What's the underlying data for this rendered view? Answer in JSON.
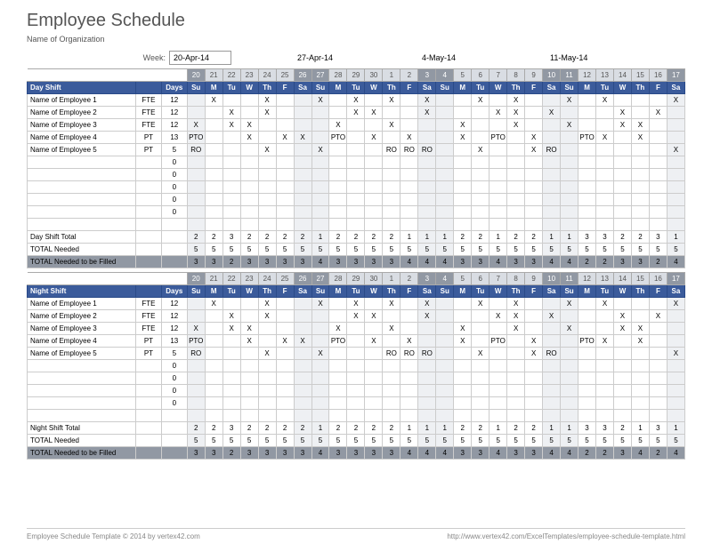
{
  "title": "Employee Schedule",
  "subtitle": "Name of Organization",
  "week_label": "Week:",
  "week_dates": [
    "20-Apr-14",
    "27-Apr-14",
    "4-May-14",
    "11-May-14"
  ],
  "col_type_blank": "",
  "col_days": "Days",
  "day_numbers": [
    "20",
    "21",
    "22",
    "23",
    "24",
    "25",
    "26",
    "27",
    "28",
    "29",
    "30",
    "1",
    "2",
    "3",
    "4",
    "5",
    "6",
    "7",
    "8",
    "9",
    "10",
    "11",
    "12",
    "13",
    "14",
    "15",
    "16",
    "17"
  ],
  "day_abbr": [
    "Su",
    "M",
    "Tu",
    "W",
    "Th",
    "F",
    "Sa",
    "Su",
    "M",
    "Tu",
    "W",
    "Th",
    "F",
    "Sa",
    "Su",
    "M",
    "Tu",
    "W",
    "Th",
    "F",
    "Sa",
    "Su",
    "M",
    "Tu",
    "W",
    "Th",
    "F",
    "Sa"
  ],
  "weekend_idx": [
    0,
    6,
    7,
    13,
    14,
    20,
    21,
    27
  ],
  "shifts": [
    {
      "name": "Day Shift",
      "employees": [
        {
          "n": "Name of Employee 1",
          "t": "FTE",
          "d": "12",
          "marks": [
            "",
            "X",
            "",
            "",
            "X",
            "",
            "",
            "X",
            "",
            "X",
            "",
            "X",
            "",
            "X",
            "",
            "",
            "X",
            "",
            "X",
            "",
            "",
            "X",
            "",
            "X",
            "",
            "",
            "",
            "X"
          ]
        },
        {
          "n": "Name of Employee 2",
          "t": "FTE",
          "d": "12",
          "marks": [
            "",
            "",
            "X",
            "",
            "X",
            "",
            "",
            "",
            "",
            "X",
            "X",
            "",
            "",
            "X",
            "",
            "",
            "",
            "X",
            "X",
            "",
            "X",
            "",
            "",
            "",
            "X",
            "",
            "X",
            ""
          ]
        },
        {
          "n": "Name of Employee 3",
          "t": "FTE",
          "d": "12",
          "marks": [
            "X",
            "",
            "X",
            "X",
            "",
            "",
            "",
            "",
            "X",
            "",
            "",
            "X",
            "",
            "",
            "",
            "X",
            "",
            "",
            "X",
            "",
            "",
            "X",
            "",
            "",
            "X",
            "X",
            "",
            ""
          ]
        },
        {
          "n": "Name of Employee 4",
          "t": "PT",
          "d": "13",
          "marks": [
            "PTO",
            "",
            "",
            "X",
            "",
            "X",
            "X",
            "",
            "PTO",
            "",
            "X",
            "",
            "X",
            "",
            "",
            "X",
            "",
            "PTO",
            "",
            "X",
            "",
            "",
            "PTO",
            "X",
            "",
            "X",
            "",
            ""
          ]
        },
        {
          "n": "Name of Employee 5",
          "t": "PT",
          "d": "5",
          "marks": [
            "RO",
            "",
            "",
            "",
            "X",
            "",
            "",
            "X",
            "",
            "",
            "",
            "RO",
            "RO",
            "RO",
            "",
            "",
            "X",
            "",
            "",
            "X",
            "RO",
            "",
            "",
            "",
            "",
            "",
            "",
            "X"
          ]
        }
      ],
      "empty_rows": 5,
      "total_label": "Day Shift Total",
      "total": [
        "2",
        "2",
        "3",
        "2",
        "2",
        "2",
        "2",
        "1",
        "2",
        "2",
        "2",
        "2",
        "1",
        "1",
        "1",
        "2",
        "2",
        "1",
        "2",
        "2",
        "1",
        "1",
        "3",
        "3",
        "2",
        "2",
        "3",
        "1"
      ],
      "need_label": "TOTAL Needed",
      "need": [
        "5",
        "5",
        "5",
        "5",
        "5",
        "5",
        "5",
        "5",
        "5",
        "5",
        "5",
        "5",
        "5",
        "5",
        "5",
        "5",
        "5",
        "5",
        "5",
        "5",
        "5",
        "5",
        "5",
        "5",
        "5",
        "5",
        "5",
        "5"
      ],
      "fill_label": "TOTAL Needed to be Filled",
      "fill": [
        "3",
        "3",
        "2",
        "3",
        "3",
        "3",
        "3",
        "4",
        "3",
        "3",
        "3",
        "3",
        "4",
        "4",
        "4",
        "3",
        "3",
        "4",
        "3",
        "3",
        "4",
        "4",
        "2",
        "2",
        "3",
        "3",
        "2",
        "4"
      ]
    },
    {
      "name": "Night Shift",
      "employees": [
        {
          "n": "Name of Employee 1",
          "t": "FTE",
          "d": "12",
          "marks": [
            "",
            "X",
            "",
            "",
            "X",
            "",
            "",
            "X",
            "",
            "X",
            "",
            "X",
            "",
            "X",
            "",
            "",
            "X",
            "",
            "X",
            "",
            "",
            "X",
            "",
            "X",
            "",
            "",
            "",
            "X"
          ]
        },
        {
          "n": "Name of Employee 2",
          "t": "FTE",
          "d": "12",
          "marks": [
            "",
            "",
            "X",
            "",
            "X",
            "",
            "",
            "",
            "",
            "X",
            "X",
            "",
            "",
            "X",
            "",
            "",
            "",
            "X",
            "X",
            "",
            "X",
            "",
            "",
            "",
            "X",
            "",
            "X",
            ""
          ]
        },
        {
          "n": "Name of Employee 3",
          "t": "FTE",
          "d": "12",
          "marks": [
            "X",
            "",
            "X",
            "X",
            "",
            "",
            "",
            "",
            "X",
            "",
            "",
            "X",
            "",
            "",
            "",
            "X",
            "",
            "",
            "X",
            "",
            "",
            "X",
            "",
            "",
            "X",
            "X",
            "",
            ""
          ]
        },
        {
          "n": "Name of Employee 4",
          "t": "PT",
          "d": "13",
          "marks": [
            "PTO",
            "",
            "",
            "X",
            "",
            "X",
            "X",
            "",
            "PTO",
            "",
            "X",
            "",
            "X",
            "",
            "",
            "X",
            "",
            "PTO",
            "",
            "X",
            "",
            "",
            "PTO",
            "X",
            "",
            "X",
            "",
            ""
          ]
        },
        {
          "n": "Name of Employee 5",
          "t": "PT",
          "d": "5",
          "marks": [
            "RO",
            "",
            "",
            "",
            "X",
            "",
            "",
            "X",
            "",
            "",
            "",
            "RO",
            "RO",
            "RO",
            "",
            "",
            "X",
            "",
            "",
            "X",
            "RO",
            "",
            "",
            "",
            "",
            "",
            "",
            "X"
          ]
        }
      ],
      "empty_rows": 4,
      "total_label": "Night Shift Total",
      "total": [
        "2",
        "2",
        "3",
        "2",
        "2",
        "2",
        "2",
        "1",
        "2",
        "2",
        "2",
        "2",
        "1",
        "1",
        "1",
        "2",
        "2",
        "1",
        "2",
        "2",
        "1",
        "1",
        "3",
        "3",
        "2",
        "1",
        "3",
        "1"
      ],
      "need_label": "TOTAL Needed",
      "need": [
        "5",
        "5",
        "5",
        "5",
        "5",
        "5",
        "5",
        "5",
        "5",
        "5",
        "5",
        "5",
        "5",
        "5",
        "5",
        "5",
        "5",
        "5",
        "5",
        "5",
        "5",
        "5",
        "5",
        "5",
        "5",
        "5",
        "5",
        "5"
      ],
      "fill_label": "TOTAL Needed to be Filled",
      "fill": [
        "3",
        "3",
        "2",
        "3",
        "3",
        "3",
        "3",
        "4",
        "3",
        "3",
        "3",
        "3",
        "4",
        "4",
        "4",
        "3",
        "3",
        "4",
        "3",
        "3",
        "4",
        "4",
        "2",
        "2",
        "3",
        "4",
        "2",
        "4"
      ]
    }
  ],
  "footer_left": "Employee Schedule Template © 2014 by vertex42.com",
  "footer_right": "http://www.vertex42.com/ExcelTemplates/employee-schedule-template.html"
}
